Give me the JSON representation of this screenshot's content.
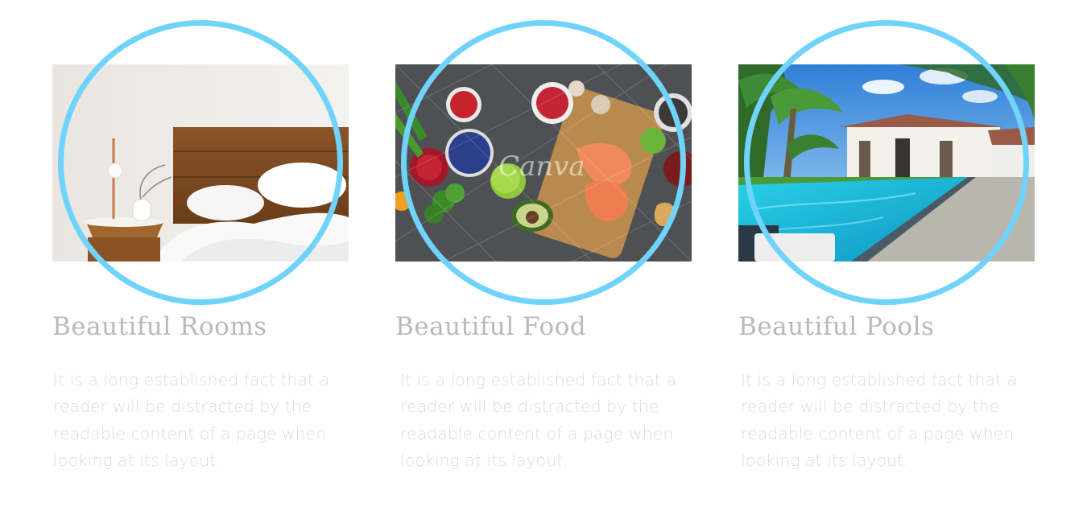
{
  "features": [
    {
      "title": "Beautiful Rooms",
      "text": "It is a long established fact that a reader will be distracted by the readable content of a page when looking at its layout.",
      "image": "bedroom-photo"
    },
    {
      "title": "Beautiful Food",
      "text": "It is a long established fact that a reader will be distracted by the readable content of a page when looking at its layout.",
      "image": "food-photo",
      "watermark": "Canva"
    },
    {
      "title": "Beautiful Pools",
      "text": "It is a long established fact that a reader will be distracted by the readable content of a page when looking at its layout.",
      "image": "pool-photo"
    }
  ],
  "colors": {
    "ring": "#6fd3fb",
    "title": "#b9b9b9",
    "text": "#dcdcdc"
  }
}
